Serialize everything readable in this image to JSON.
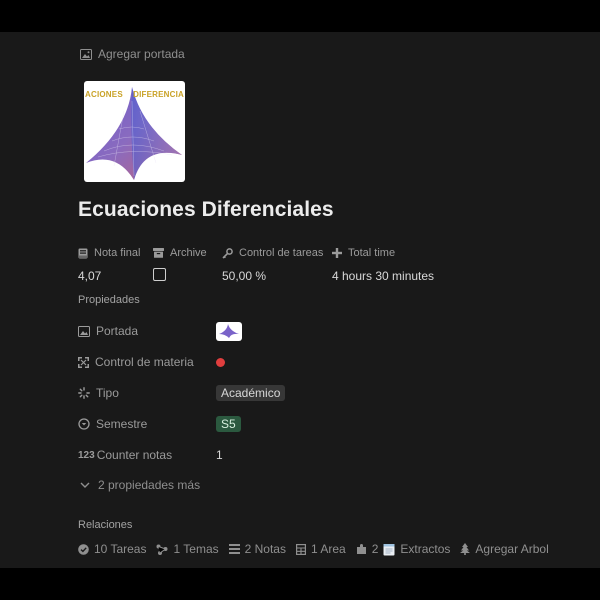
{
  "header": {
    "add_cover_label": "Agregar portada",
    "page_icon_banner_left": "ACIONES",
    "page_icon_banner_right": "DIFERENCIA",
    "title": "Ecuaciones Diferenciales"
  },
  "header_properties": [
    {
      "name": "Nota final",
      "icon": "document-icon",
      "value": "4,07"
    },
    {
      "name": "Archive",
      "icon": "archive-box-icon",
      "value_type": "checkbox",
      "checked": false
    },
    {
      "name": "Control de tareas",
      "icon": "key-icon",
      "value": "50,00 %"
    },
    {
      "name": "Total time",
      "icon": "plus-icon",
      "value": "4 hours 30 minutes"
    }
  ],
  "properties": {
    "section_label": "Propiedades",
    "items": [
      {
        "name": "Portada",
        "icon": "image-icon",
        "value_type": "thumbnail"
      },
      {
        "name": "Control de materia",
        "icon": "expand-icon",
        "value_type": "status-dot",
        "color": "#e03e3e"
      },
      {
        "name": "Tipo",
        "icon": "loading-spinner-icon",
        "value": "Académico",
        "tag_color": "#373737"
      },
      {
        "name": "Semestre",
        "icon": "chevron-circle-icon",
        "value": "S5",
        "tag_color": "#2b593f"
      },
      {
        "name": "Counter notas",
        "icon": "number-icon",
        "icon_text": "123",
        "value": "1"
      }
    ],
    "more_label": "2 propiedades más"
  },
  "relations": {
    "section_label": "Relaciones",
    "items": [
      {
        "label": "10 Tareas",
        "icon": "check-circle-icon"
      },
      {
        "label": "1 Temas",
        "icon": "tree-icon"
      },
      {
        "label": "2 Notas",
        "icon": "lines-icon"
      },
      {
        "label": "1 Area",
        "icon": "grid-icon"
      },
      {
        "label": "2",
        "icon": "puzzle-icon"
      },
      {
        "label": "Extractos",
        "icon": "memo-icon"
      },
      {
        "label": "Agregar Arbol",
        "icon": "pine-tree-icon"
      }
    ]
  },
  "colors": {
    "background": "#191919",
    "text": "#d4d4d4",
    "muted": "#8f8f8f",
    "status_red": "#e03e3e",
    "tag_gray": "#373737",
    "tag_green": "#2b593f"
  }
}
